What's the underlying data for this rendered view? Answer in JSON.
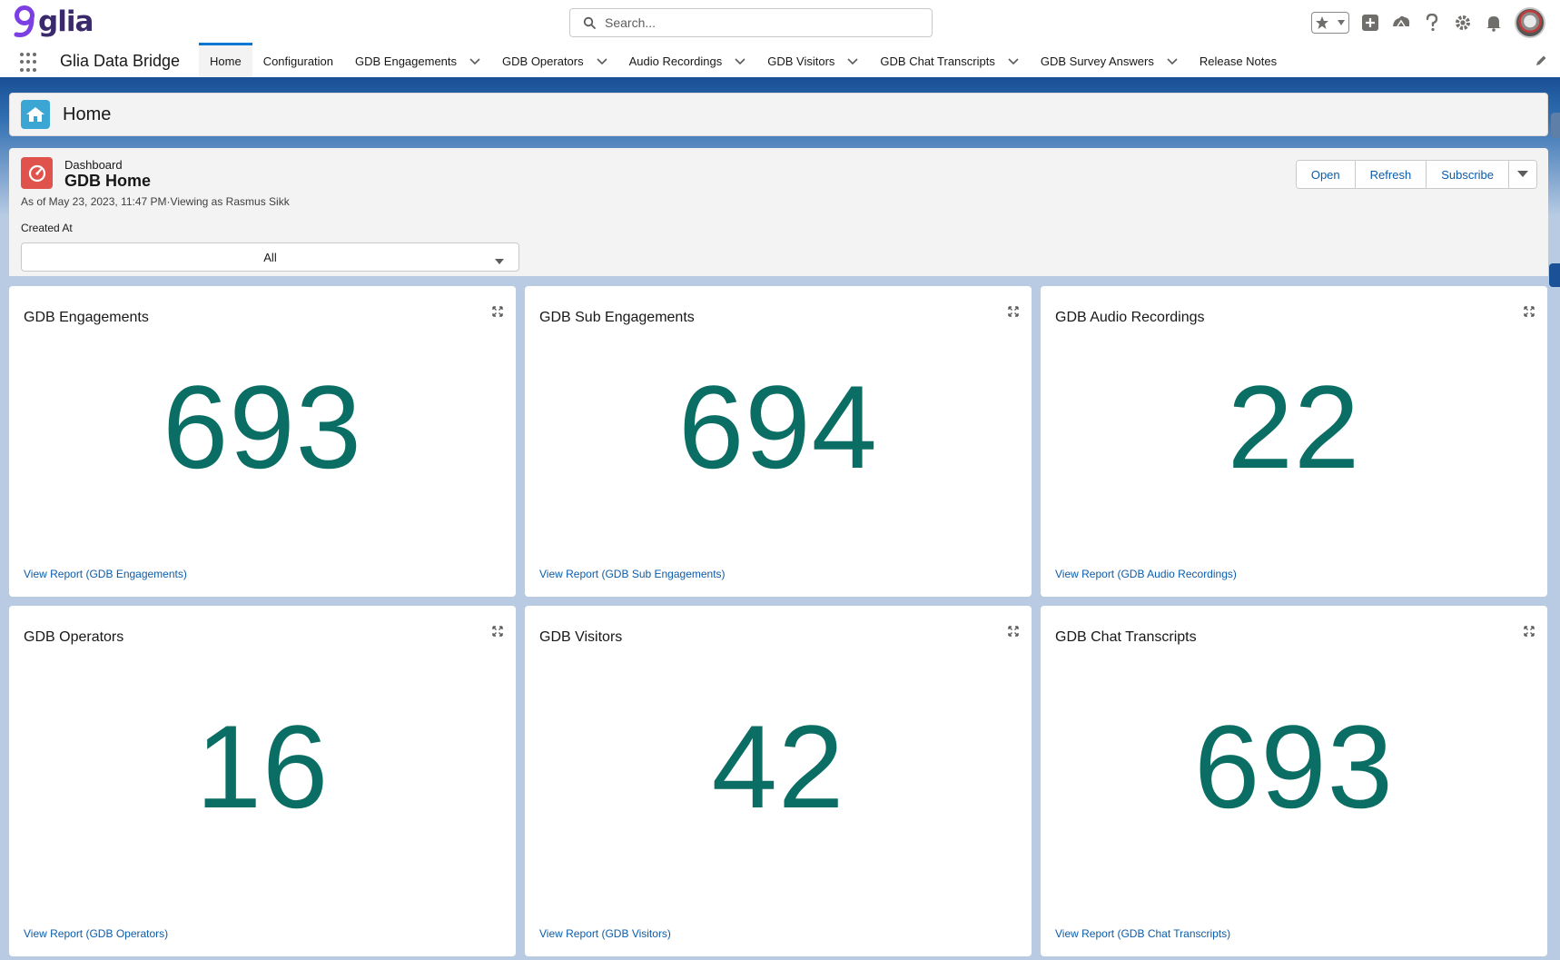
{
  "header": {
    "logo_text": "glia",
    "search_placeholder": "Search...",
    "icons": [
      "favorites-star-icon",
      "add-icon",
      "trailhead-icon",
      "help-icon",
      "settings-gear-icon",
      "notifications-bell-icon",
      "avatar"
    ]
  },
  "nav": {
    "app_name": "Glia Data Bridge",
    "tabs": [
      {
        "label": "Home",
        "active": true,
        "dropdown": false
      },
      {
        "label": "Configuration",
        "active": false,
        "dropdown": false
      },
      {
        "label": "GDB Engagements",
        "active": false,
        "dropdown": true
      },
      {
        "label": "GDB Operators",
        "active": false,
        "dropdown": true
      },
      {
        "label": "Audio Recordings",
        "active": false,
        "dropdown": true
      },
      {
        "label": "GDB Visitors",
        "active": false,
        "dropdown": true
      },
      {
        "label": "GDB Chat Transcripts",
        "active": false,
        "dropdown": true
      },
      {
        "label": "GDB Survey Answers",
        "active": false,
        "dropdown": true
      },
      {
        "label": "Release Notes",
        "active": false,
        "dropdown": false
      }
    ]
  },
  "page": {
    "title": "Home"
  },
  "dashboard": {
    "kicker": "Dashboard",
    "title": "GDB Home",
    "meta": "As of May 23, 2023, 11:47 PM·Viewing as Rasmus Sikk",
    "buttons": {
      "open": "Open",
      "refresh": "Refresh",
      "subscribe": "Subscribe"
    },
    "filter": {
      "label": "Created At",
      "value": "All"
    }
  },
  "cards": [
    {
      "title": "GDB Engagements",
      "value": "693",
      "link": "View Report (GDB Engagements)"
    },
    {
      "title": "GDB Sub Engagements",
      "value": "694",
      "link": "View Report (GDB Sub Engagements)"
    },
    {
      "title": "GDB Audio Recordings",
      "value": "22",
      "link": "View Report (GDB Audio Recordings)"
    },
    {
      "title": "GDB Operators",
      "value": "16",
      "link": "View Report (GDB Operators)"
    },
    {
      "title": "GDB Visitors",
      "value": "42",
      "link": "View Report (GDB Visitors)"
    },
    {
      "title": "GDB Chat Transcripts",
      "value": "693",
      "link": "View Report (GDB Chat Transcripts)"
    }
  ],
  "colors": {
    "metric": "#0b6e65",
    "link": "#0b5cab",
    "brand_nav": "#1b5297",
    "dashboard_icon": "#e0534c",
    "home_icon": "#3ba6d3"
  }
}
